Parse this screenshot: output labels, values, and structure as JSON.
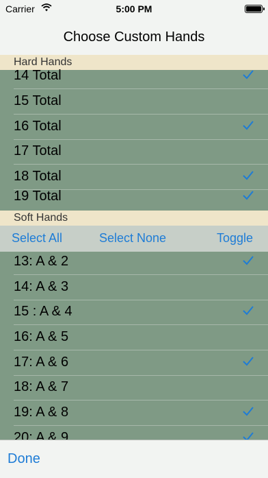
{
  "status_bar": {
    "carrier": "Carrier",
    "time": "5:00 PM"
  },
  "nav": {
    "title": "Choose Custom Hands"
  },
  "hard_hands": {
    "header": "Hard Hands",
    "rows": [
      {
        "label": "14 Total",
        "checked": true
      },
      {
        "label": "15 Total",
        "checked": false
      },
      {
        "label": "16 Total",
        "checked": true
      },
      {
        "label": "17 Total",
        "checked": false
      },
      {
        "label": "18 Total",
        "checked": true
      },
      {
        "label": "19 Total",
        "checked": true
      }
    ]
  },
  "soft_hands": {
    "header": "Soft Hands",
    "actions": {
      "select_all": "Select All",
      "select_none": "Select None",
      "toggle": "Toggle"
    },
    "rows": [
      {
        "label": "13: A & 2",
        "checked": true
      },
      {
        "label": "14: A & 3",
        "checked": false
      },
      {
        "label": "15 : A & 4",
        "checked": true
      },
      {
        "label": "16: A & 5",
        "checked": false
      },
      {
        "label": "17: A & 6",
        "checked": true
      },
      {
        "label": "18: A & 7",
        "checked": false
      },
      {
        "label": "19: A & 8",
        "checked": true
      },
      {
        "label": "20: A & 9",
        "checked": true
      }
    ]
  },
  "toolbar": {
    "done_label": "Done"
  },
  "colors": {
    "accent": "#1e7cd6",
    "table_bg": "#7f9a85",
    "section_header_bg": "#efe5c9"
  }
}
